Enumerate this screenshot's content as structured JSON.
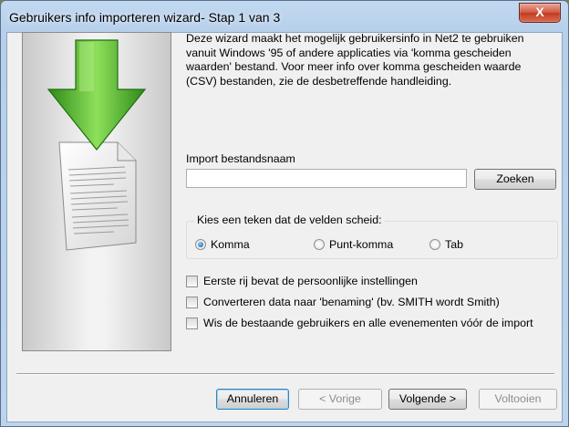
{
  "window": {
    "title": "Gebruikers info importeren wizard- Stap 1 van 3",
    "close_glyph": "X"
  },
  "intro_text": "Deze wizard maakt het mogelijk gebruikersinfo in Net2 te gebruiken vanuit Windows '95 of andere applicaties via 'komma gescheiden waarden' bestand. Voor meer info over komma gescheiden waarde (CSV) bestanden, zie de desbetreffende handleiding.",
  "import": {
    "label": "Import bestandsnaam",
    "value": "",
    "browse_label": "Zoeken"
  },
  "separator": {
    "legend": "Kies een teken dat de velden scheid:",
    "options": [
      {
        "label": "Komma",
        "selected": true
      },
      {
        "label": "Punt-komma",
        "selected": false
      },
      {
        "label": "Tab",
        "selected": false
      }
    ]
  },
  "options": [
    {
      "label": "Eerste rij bevat de persoonlijke instellingen",
      "checked": false
    },
    {
      "label": "Converteren data naar 'benaming' (bv. SMITH wordt Smith)",
      "checked": false
    },
    {
      "label": "Wis de bestaande gebruikers en alle evenementen vóór de import",
      "checked": false
    }
  ],
  "buttons": {
    "cancel": "Annuleren",
    "back": "< Vorige",
    "next": "Volgende >",
    "finish": "Voltooien"
  },
  "colors": {
    "desktop": "#6d8a3c",
    "arrow": "#4caf28",
    "close": "#c13a22"
  },
  "icons": {
    "art": "import-document-arrow-icon"
  }
}
